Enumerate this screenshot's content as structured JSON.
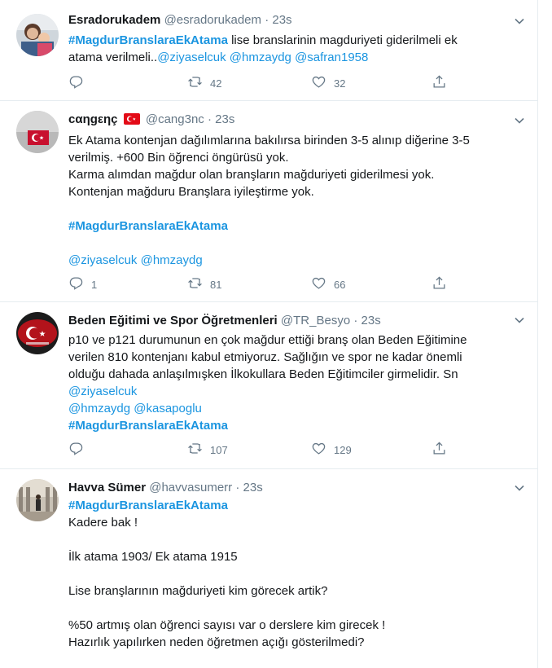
{
  "tweets": [
    {
      "name": "Esradorukadem",
      "handle": "@esradorukadem",
      "time": "23s",
      "lines": [
        [
          {
            "t": "tag",
            "v": "#MagdurBranslaraEkAtama"
          },
          {
            "t": "text",
            "v": " lise branslarinin magduriyeti giderilmeli ek"
          }
        ],
        [
          {
            "t": "text",
            "v": "atama verilmeli.."
          },
          {
            "t": "mention",
            "v": "@ziyaselcuk"
          },
          {
            "t": "text",
            "v": " "
          },
          {
            "t": "mention",
            "v": "@hmzaydg"
          },
          {
            "t": "text",
            "v": " "
          },
          {
            "t": "mention",
            "v": "@safran1958"
          }
        ]
      ],
      "replies": "",
      "retweets": "42",
      "likes": "32"
    },
    {
      "name": "cαηgεηç",
      "name_icon": "turkey-flag-icon",
      "handle": "@cang3nc",
      "time": "23s",
      "lines": [
        [
          {
            "t": "text",
            "v": "Ek Atama kontenjan dağılımlarına bakılırsa birinden 3-5 alınıp diğerine 3-5"
          }
        ],
        [
          {
            "t": "text",
            "v": "verilmiş.  +600 Bin öğrenci öngürüsü yok."
          }
        ],
        [
          {
            "t": "text",
            "v": "Karma alımdan mağdur olan branşların mağduriyeti giderilmesi yok."
          }
        ],
        [
          {
            "t": "text",
            "v": "Kontenjan mağduru Branşlara iyileştirme yok."
          }
        ],
        [],
        [
          {
            "t": "tag",
            "v": "#MagdurBranslaraEkAtama"
          }
        ],
        [],
        [
          {
            "t": "mention",
            "v": "@ziyaselcuk"
          },
          {
            "t": "text",
            "v": " "
          },
          {
            "t": "mention",
            "v": "@hmzaydg"
          }
        ]
      ],
      "replies": "1",
      "retweets": "81",
      "likes": "66"
    },
    {
      "name": "Beden Eğitimi ve Spor Öğretmenleri",
      "handle": "@TR_Besyo",
      "time": "23s",
      "lines": [
        [
          {
            "t": "text",
            "v": "p10 ve p121 durumunun en çok mağdur ettiği branş olan Beden Eğitimine"
          }
        ],
        [
          {
            "t": "text",
            "v": "verilen 810 kontenjanı kabul etmiyoruz. Sağlığın ve spor ne kadar önemli"
          }
        ],
        [
          {
            "t": "text",
            "v": "olduğu dahada anlaşılmışken İlkokullara Beden Eğitimciler girmelidir. Sn"
          }
        ],
        [
          {
            "t": "mention",
            "v": "@ziyaselcuk"
          }
        ],
        [
          {
            "t": "mention",
            "v": "@hmzaydg"
          },
          {
            "t": "text",
            "v": " "
          },
          {
            "t": "mention",
            "v": "@kasapoglu"
          }
        ],
        [
          {
            "t": "tag",
            "v": "#MagdurBranslaraEkAtama"
          }
        ]
      ],
      "replies": "",
      "retweets": "107",
      "likes": "129"
    },
    {
      "name": "Havva Sümer",
      "handle": "@havvasumerr",
      "time": "23s",
      "lines": [
        [
          {
            "t": "tag",
            "v": "#MagdurBranslaraEkAtama"
          }
        ],
        [
          {
            "t": "text",
            "v": "Kadere bak !"
          }
        ],
        [],
        [
          {
            "t": "text",
            "v": "İlk atama 1903/ Ek atama 1915"
          }
        ],
        [],
        [
          {
            "t": "text",
            "v": "Lise branşlarının mağduriyeti kim görecek artik?"
          }
        ],
        [],
        [
          {
            "t": "text",
            "v": "%50 artmış olan öğrenci sayısı var o derslere kim girecek !"
          }
        ],
        [
          {
            "t": "text",
            "v": "Hazırlık yapılırken neden öğretmen açığı gösterilmedi?"
          }
        ]
      ]
    }
  ],
  "colors": {
    "link": "#1b95e0",
    "muted": "#657786",
    "text": "#14171a",
    "border": "#e6ecf0"
  }
}
